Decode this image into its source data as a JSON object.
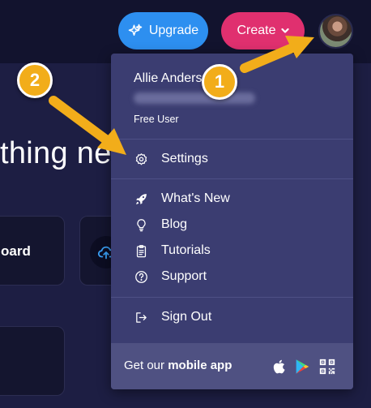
{
  "header": {
    "upgrade_label": "Upgrade",
    "create_label": "Create"
  },
  "background": {
    "heading_fragment": "thing ne",
    "card_label_fragment": "oard"
  },
  "user_menu": {
    "name": "Allie Anders",
    "plan": "Free User",
    "items": [
      {
        "label": "Settings",
        "icon": "gear-icon"
      },
      {
        "label": "What's New",
        "icon": "rocket-icon"
      },
      {
        "label": "Blog",
        "icon": "lightbulb-icon"
      },
      {
        "label": "Tutorials",
        "icon": "clipboard-icon"
      },
      {
        "label": "Support",
        "icon": "question-circle-icon"
      },
      {
        "label": "Sign Out",
        "icon": "sign-out-icon"
      }
    ],
    "footer": {
      "prefix": "Get our ",
      "bold": "mobile app"
    }
  },
  "annotations": {
    "badge_1": "1",
    "badge_2": "2"
  },
  "colors": {
    "upgrade": "#2d8ff0",
    "create": "#e0306f",
    "menu_bg": "#3b3d71",
    "badge": "#f2ad1a"
  }
}
